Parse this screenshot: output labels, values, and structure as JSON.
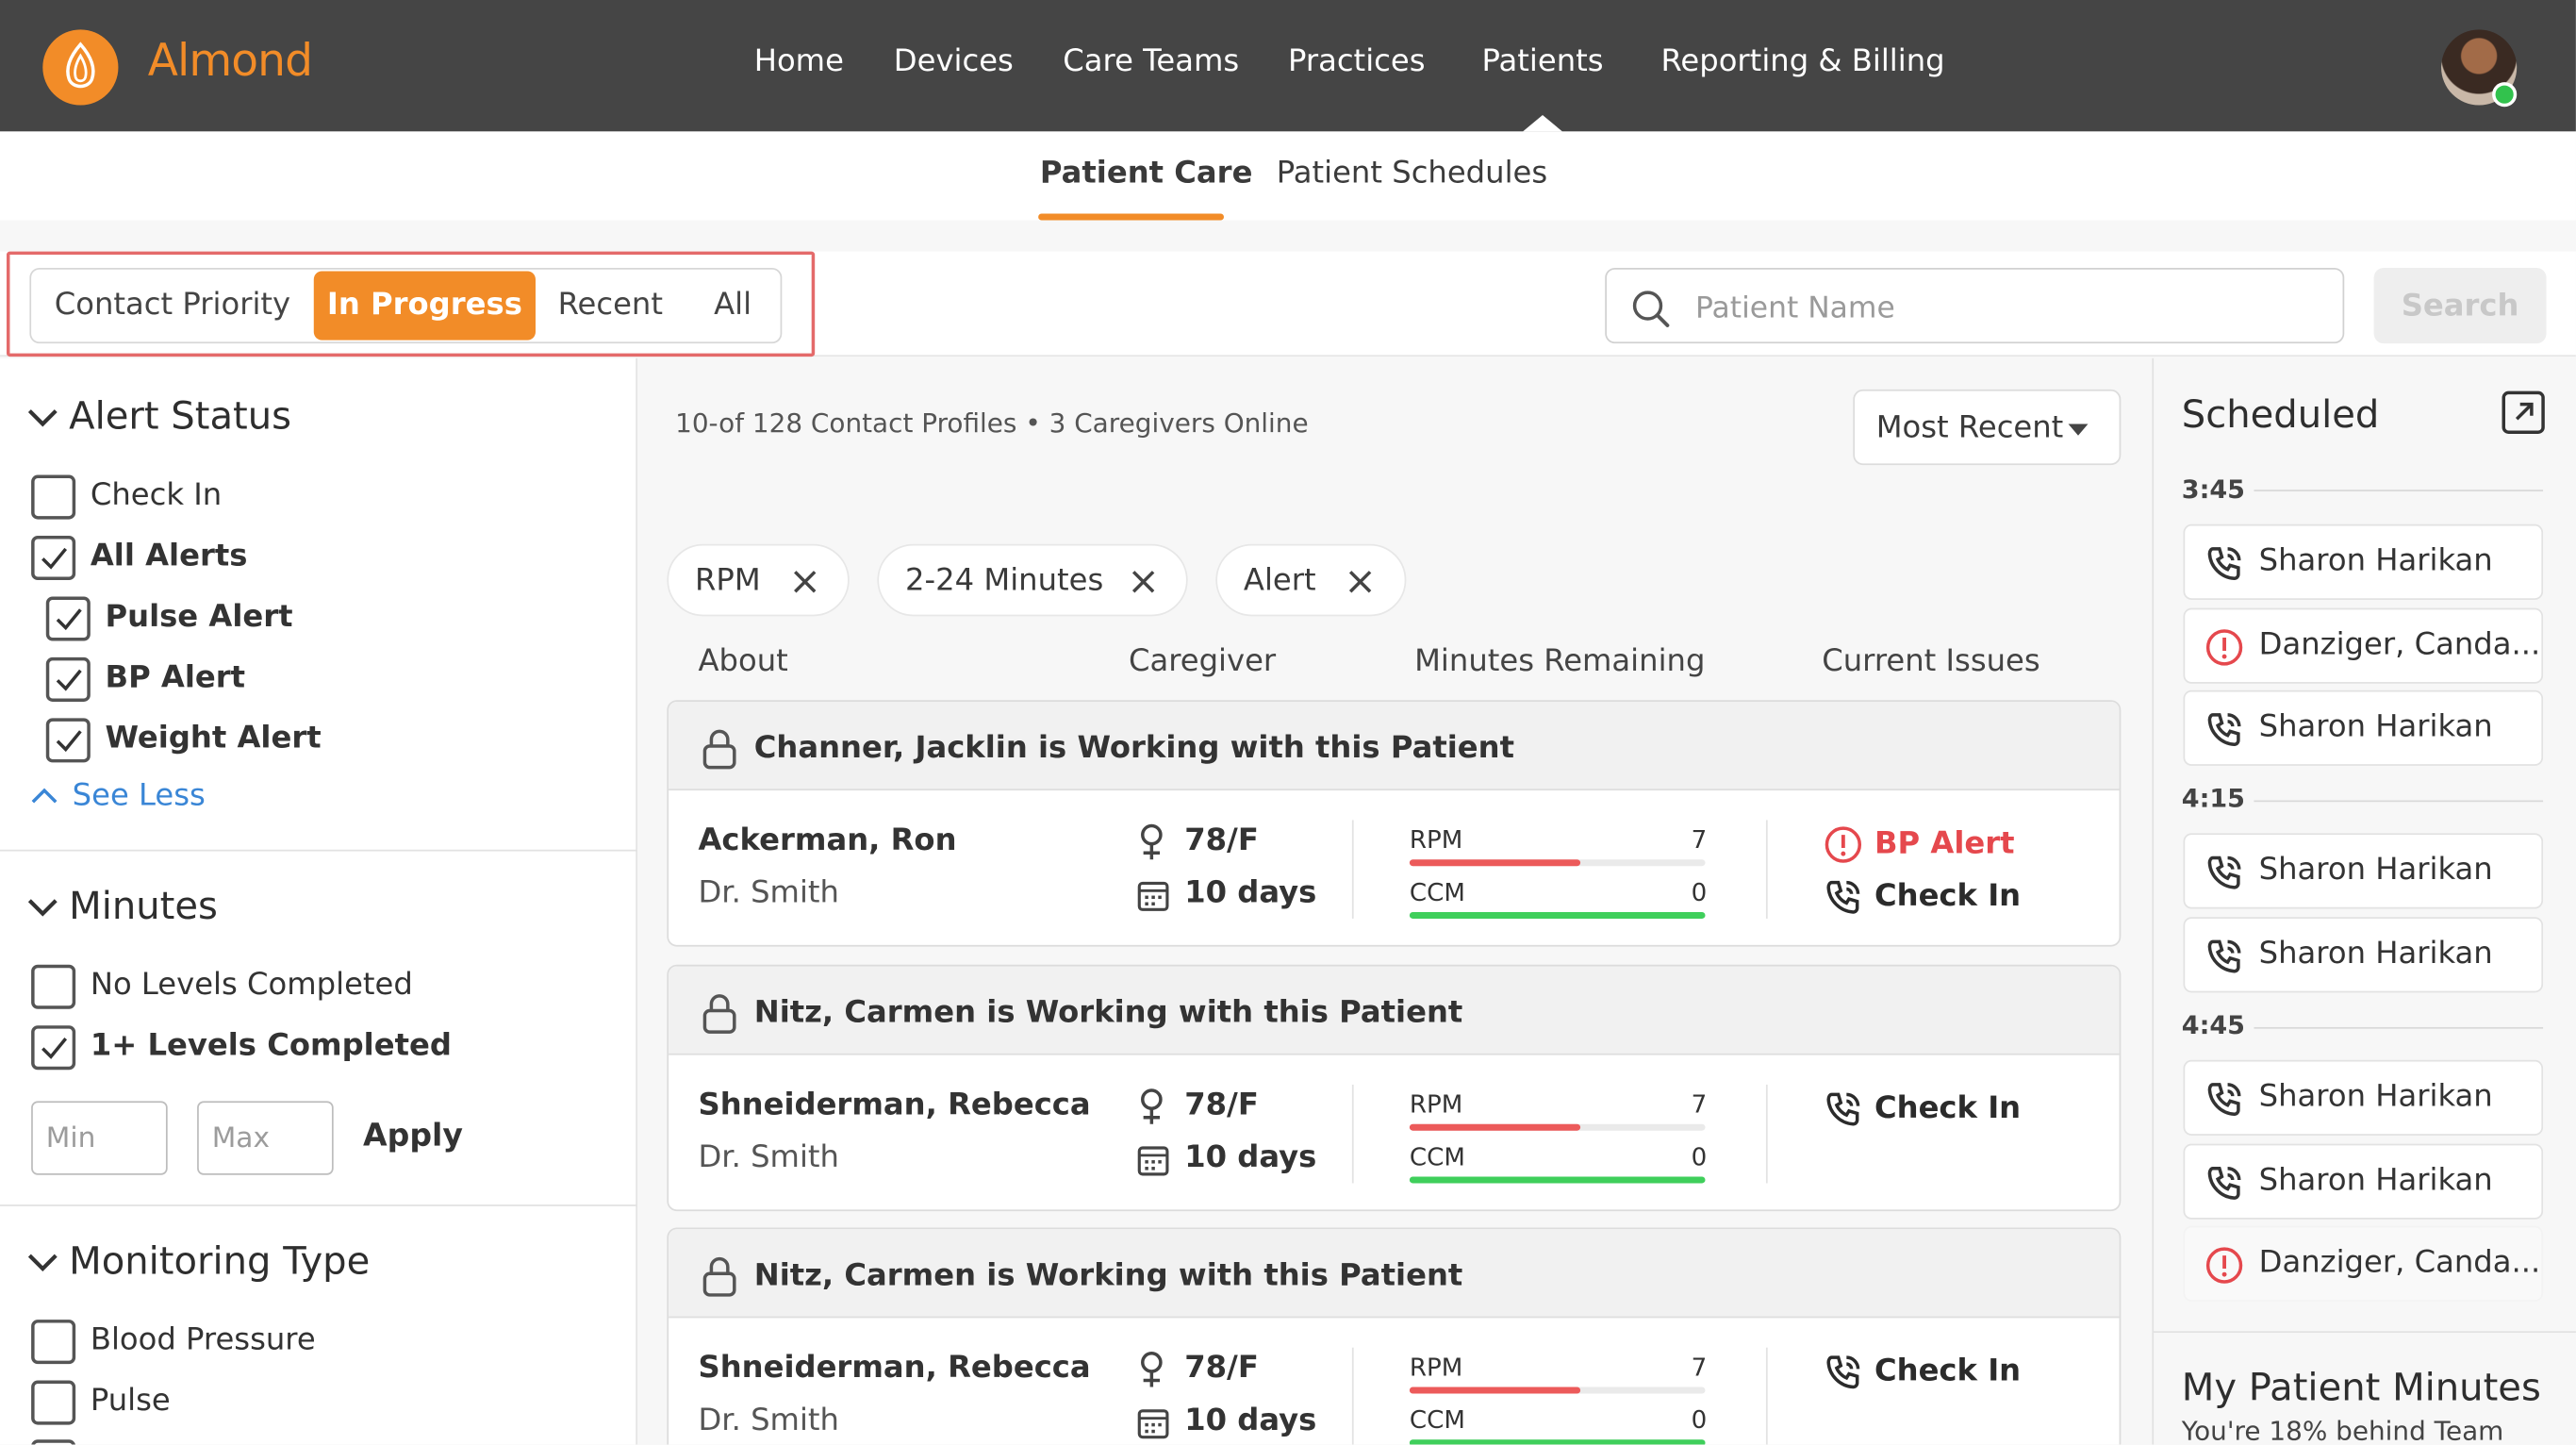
{
  "app": {
    "name": "Almond",
    "brand_color": "#f28c28"
  },
  "nav": {
    "items": [
      "Home",
      "Devices",
      "Care Teams",
      "Practices",
      "Patients",
      "Reporting & Billing"
    ],
    "active": "Patients"
  },
  "subnav": {
    "tabs": [
      "Patient Care",
      "Patient Schedules"
    ],
    "active": "Patient Care"
  },
  "segments": {
    "items": [
      "Contact Priority",
      "In Progress",
      "Recent",
      "All"
    ],
    "active": "In Progress"
  },
  "search": {
    "placeholder": "Patient Name",
    "button": "Search"
  },
  "sidebar": {
    "alert_status": {
      "title": "Alert Status",
      "options": [
        {
          "label": "Check In",
          "checked": false
        },
        {
          "label": "All Alerts",
          "checked": true
        },
        {
          "label": "Pulse Alert",
          "checked": true
        },
        {
          "label": "BP Alert",
          "checked": true
        },
        {
          "label": "Weight Alert",
          "checked": true
        }
      ],
      "see_less": "See Less"
    },
    "minutes": {
      "title": "Minutes",
      "options": [
        {
          "label": "No Levels Completed",
          "checked": false
        },
        {
          "label": "1+ Levels Completed",
          "checked": true
        }
      ],
      "min_placeholder": "Min",
      "max_placeholder": "Max",
      "apply": "Apply"
    },
    "monitoring_type": {
      "title": "Monitoring Type",
      "options": [
        {
          "label": "Blood Pressure",
          "checked": false
        },
        {
          "label": "Pulse",
          "checked": false
        }
      ]
    }
  },
  "main": {
    "summary": "10-of 128 Contact Profiles  •  3 Caregivers Online",
    "sort": "Most Recent",
    "chips": [
      "RPM",
      "2-24 Minutes",
      "Alert"
    ],
    "columns": [
      "About",
      "Caregiver",
      "Minutes Remaining",
      "Current Issues"
    ],
    "cards": [
      {
        "lock_message": "Channer, Jacklin is Working with this Patient",
        "name": "Ackerman, Ron",
        "doctor": "Dr. Smith",
        "age": "78/F",
        "days": "10 days",
        "rpm_label": "RPM",
        "rpm_value": "7",
        "rpm_progress": 0.58,
        "ccm_label": "CCM",
        "ccm_value": "0",
        "ccm_progress": 1.0,
        "issues": [
          {
            "type": "alert",
            "label": "BP Alert"
          },
          {
            "type": "checkin",
            "label": "Check In"
          }
        ]
      },
      {
        "lock_message": "Nitz, Carmen is Working with this Patient",
        "name": "Shneiderman, Rebecca",
        "doctor": "Dr. Smith",
        "age": "78/F",
        "days": "10 days",
        "rpm_label": "RPM",
        "rpm_value": "7",
        "rpm_progress": 0.58,
        "ccm_label": "CCM",
        "ccm_value": "0",
        "ccm_progress": 1.0,
        "issues": [
          {
            "type": "checkin",
            "label": "Check In"
          }
        ]
      },
      {
        "lock_message": "Nitz, Carmen is Working with this Patient",
        "name": "Shneiderman, Rebecca",
        "doctor": "Dr. Smith",
        "age": "78/F",
        "days": "10 days",
        "rpm_label": "RPM",
        "rpm_value": "7",
        "rpm_progress": 0.58,
        "ccm_label": "CCM",
        "ccm_value": "0",
        "ccm_progress": 1.0,
        "issues": [
          {
            "type": "checkin",
            "label": "Check In"
          }
        ]
      }
    ]
  },
  "scheduled": {
    "title": "Scheduled",
    "groups": [
      {
        "time": "3:45",
        "items": [
          {
            "type": "call",
            "name": "Sharon Harikan"
          },
          {
            "type": "alert",
            "name": "Danziger, Canda..."
          },
          {
            "type": "call",
            "name": "Sharon Harikan"
          }
        ]
      },
      {
        "time": "4:15",
        "items": [
          {
            "type": "call",
            "name": "Sharon Harikan"
          },
          {
            "type": "call",
            "name": "Sharon Harikan"
          }
        ]
      },
      {
        "time": "4:45",
        "items": [
          {
            "type": "call",
            "name": "Sharon Harikan"
          },
          {
            "type": "call",
            "name": "Sharon Harikan"
          },
          {
            "type": "alert",
            "name": "Danziger, Canda..."
          }
        ]
      }
    ]
  },
  "my_minutes": {
    "title": "My Patient Minutes",
    "subtitle": "You're 18% behind Team"
  },
  "colors": {
    "alert": "#e5484d",
    "rpm_bar": "#ec5a5a",
    "ccm_bar": "#3fcf5b",
    "link": "#3a86d6"
  }
}
